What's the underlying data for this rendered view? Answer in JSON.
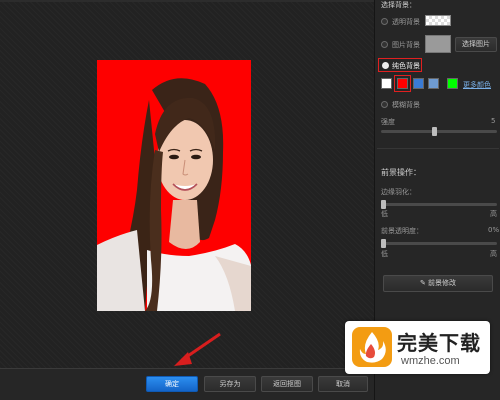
{
  "panel": {
    "section_title": "选择背景：",
    "options": {
      "transparent": "透明背景",
      "image": "图片背景",
      "choose_image_button": "选择图片",
      "solid": "纯色背景",
      "blur": "模糊背景"
    },
    "swatches": [
      {
        "color": "#ffffff",
        "selected": false
      },
      {
        "color": "#ff0000",
        "selected": true
      },
      {
        "color": "#3a7bd5",
        "selected": false
      },
      {
        "color": "#6f9bd1",
        "selected": false
      },
      {
        "color": "#00ff00",
        "selected": false
      }
    ],
    "more_colors_link": "更多颜色",
    "blur_strength": {
      "label": "强度",
      "value": "5"
    },
    "foreground_title": "前景操作：",
    "edge_feather": {
      "label": "边缘羽化：",
      "min_label": "低",
      "max_label": "高"
    },
    "fg_opacity": {
      "label": "前景透明度：",
      "value": "0%",
      "min_label": "低",
      "max_label": "高"
    },
    "fg_edit_button": "前景修改"
  },
  "bottom": {
    "confirm": "确定",
    "save_as": "另存为",
    "back": "返回抠图",
    "cancel": "取消"
  },
  "watermark": {
    "title": "完美下载",
    "url": "wmzhe.com"
  },
  "colors": {
    "photo_background": "#fe0000",
    "accent_blue": "#1e78e0",
    "highlight_red": "#e02020"
  }
}
